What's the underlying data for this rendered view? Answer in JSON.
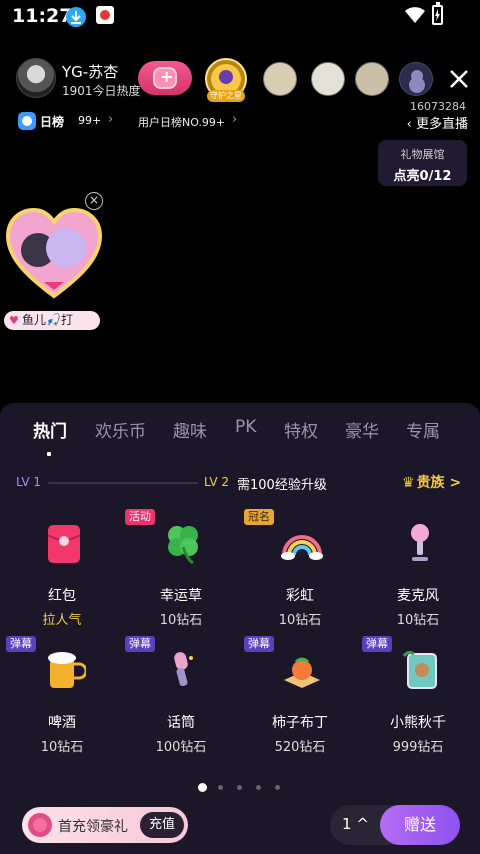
{
  "status": {
    "time": "11:27"
  },
  "live": {
    "host_name": "YG-苏杏",
    "host_heat": "1901今日热度",
    "guard_label": "守护之星",
    "room_id": "16073284",
    "rank_label": "日榜",
    "rank_value": "99+",
    "user_rank": "用户日榜NO.99+",
    "more_live": "更多直播",
    "gallery_title": "礼物展馆",
    "gallery_count": "点亮0/12",
    "name_tag": "鱼儿🎣打"
  },
  "panel": {
    "tabs": [
      {
        "label": "热门"
      },
      {
        "label": "欢乐币"
      },
      {
        "label": "趣味"
      },
      {
        "label": "PK"
      },
      {
        "label": "特权"
      },
      {
        "label": "豪华"
      },
      {
        "label": "专属"
      }
    ],
    "level": {
      "from": "LV 1",
      "to": "LV 2",
      "need": "需100经验升级",
      "progress_fraction": 0.0,
      "noble_label": "贵族",
      "noble_chevron": ">"
    },
    "gifts": [
      {
        "name": "红包",
        "price": "拉人气",
        "tag": ""
      },
      {
        "name": "幸运草",
        "price": "10钻石",
        "tag": "活动"
      },
      {
        "name": "彩虹",
        "price": "10钻石",
        "tag": "冠名"
      },
      {
        "name": "麦克风",
        "price": "10钻石",
        "tag": ""
      },
      {
        "name": "啤酒",
        "price": "10钻石",
        "tag": "弹幕"
      },
      {
        "name": "话筒",
        "price": "100钻石",
        "tag": "弹幕"
      },
      {
        "name": "柿子布丁",
        "price": "520钻石",
        "tag": "弹幕"
      },
      {
        "name": "小熊秋千",
        "price": "999钻石",
        "tag": "弹幕"
      }
    ],
    "page_total": 5,
    "page_current": 1,
    "recharge_text": "首充领豪礼",
    "recharge_button": "充值",
    "quantity": "1",
    "send_button": "赠送"
  },
  "colors": {
    "accent_purple": "#a98af7",
    "gold": "#f3d043",
    "panel_bg": "#1b1628"
  }
}
